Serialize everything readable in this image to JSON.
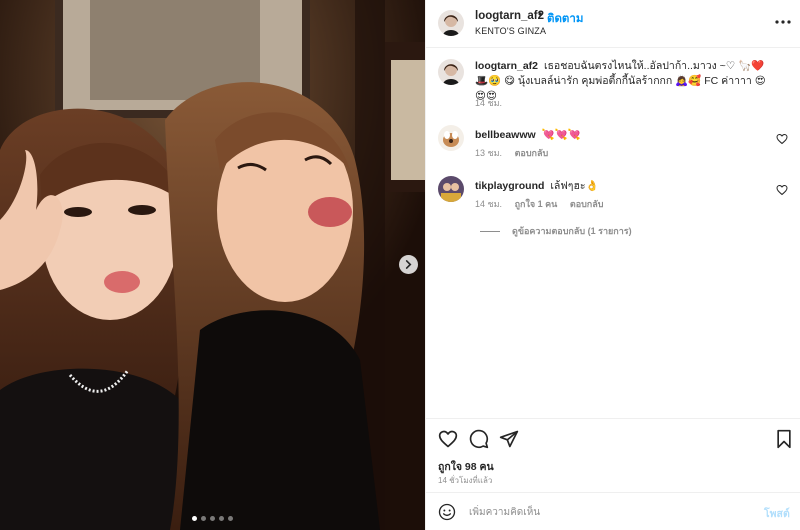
{
  "post": {
    "username": "loogtarn_af2",
    "separator": "•",
    "follow_label": "ติดตาม",
    "location": "KENTO'S GINZA"
  },
  "caption": {
    "username": "loogtarn_af2",
    "text": "เธอชอบฉันตรงไหนให้..อัลปาก้า..มาวง ~♡ 🦙❤️🎩🥹 😋 นุ้งเบลล์น่ารัก คุมพ่อตี้กกี้นัลร้ากกก 🙇‍♀️🥰 FC ค่าาาา 😍😍😍",
    "time": "14 ชม."
  },
  "comments": [
    {
      "username": "bellbeawww",
      "text": "💘💘💘",
      "time": "13 ชม.",
      "likes": "",
      "reply_label": "ตอบกลับ"
    },
    {
      "username": "tikplayground",
      "text": "เล้ฟๆฮะ👌",
      "time": "14 ชม.",
      "likes": "ถูกใจ 1 คน",
      "reply_label": "ตอบกลับ"
    }
  ],
  "view_replies_label": "ดูข้อความตอบกลับ (1 รายการ)",
  "likes_label": "ถูกใจ 98 คน",
  "time_ago": "14 ชั่วโมงที่แล้ว",
  "add_comment": {
    "placeholder": "เพิ่มความคิดเห็น",
    "post_label": "โพสต์"
  },
  "carousel": {
    "total": 5,
    "active": 1
  },
  "icons": {
    "more": "more-horizontal-icon",
    "like": "heart-icon",
    "comment": "comment-bubble-icon",
    "share": "paper-plane-icon",
    "save": "bookmark-icon",
    "emoji": "smiley-icon",
    "next": "chevron-right-icon"
  },
  "colors": {
    "link_blue": "#0095f6",
    "post_disabled": "#b2dffc",
    "muted": "#8e8e8e",
    "text": "#262626"
  }
}
